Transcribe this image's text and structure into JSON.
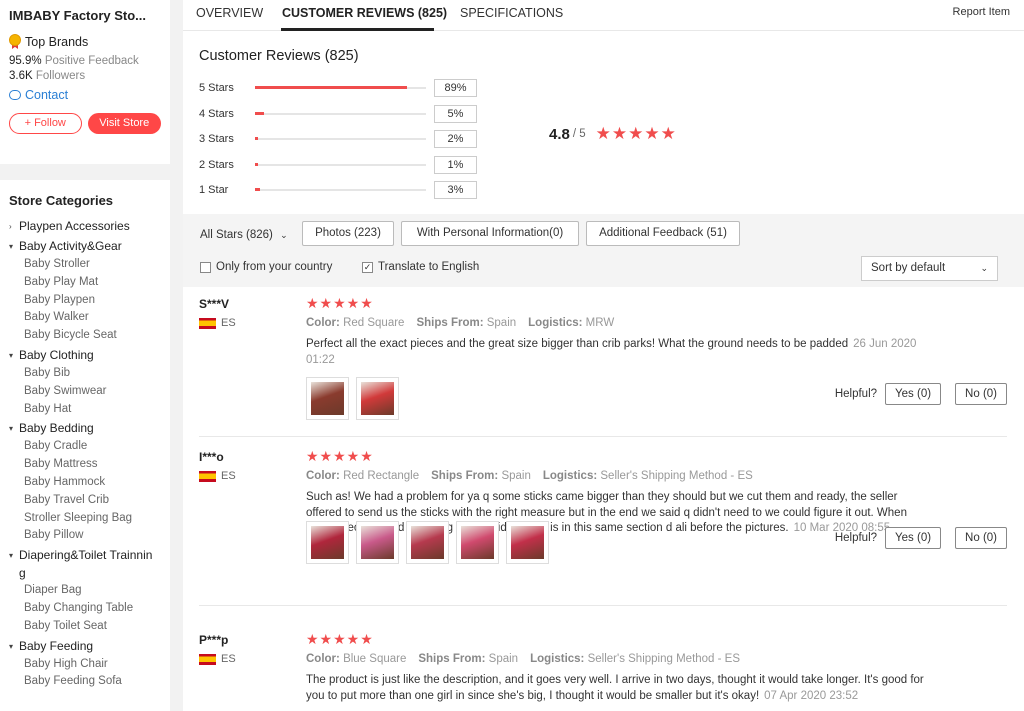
{
  "store": {
    "name": "IMBABY Factory Sto...",
    "badge": "Top Brands",
    "feedback_value": "95.9%",
    "feedback_label": "Positive Feedback",
    "followers_value": "3.6K",
    "followers_label": "Followers",
    "contact": "Contact",
    "follow_button": "+ Follow",
    "visit_button": "Visit Store"
  },
  "categories": {
    "title": "Store Categories",
    "groups": [
      {
        "label": "Playpen Accessories",
        "marker": "›",
        "items": []
      },
      {
        "label": "Baby Activity&Gear",
        "marker": "▾",
        "items": [
          "Baby Stroller",
          "Baby Play Mat",
          "Baby Playpen",
          "Baby Walker",
          "Baby Bicycle Seat"
        ]
      },
      {
        "label": "Baby Clothing",
        "marker": "▾",
        "items": [
          "Baby Bib",
          "Baby Swimwear",
          "Baby Hat"
        ]
      },
      {
        "label": "Baby Bedding",
        "marker": "▾",
        "items": [
          "Baby Cradle",
          "Baby Mattress",
          "Baby Hammock",
          "Baby Travel Crib",
          "Stroller Sleeping Bag",
          "Baby Pillow"
        ]
      },
      {
        "label": "Diapering&Toilet Trainnin g",
        "marker": "▾",
        "items": [
          "Diaper Bag",
          "Baby Changing Table",
          "Baby Toilet Seat"
        ]
      },
      {
        "label": "Baby Feeding",
        "marker": "▾",
        "items": [
          "Baby High Chair",
          "Baby Feeding Sofa"
        ]
      }
    ]
  },
  "tabs": {
    "overview": "OVERVIEW",
    "reviews": "CUSTOMER REVIEWS (825)",
    "specs": "SPECIFICATIONS",
    "report": "Report Item"
  },
  "summary": {
    "title": "Customer Reviews (825)",
    "rating": "4.8",
    "rating_of": "/ 5",
    "rating_stars": "★★★★★",
    "distribution": [
      {
        "label": "5 Stars",
        "pct": "89%",
        "value": 89
      },
      {
        "label": "4 Stars",
        "pct": "5%",
        "value": 5
      },
      {
        "label": "3 Stars",
        "pct": "2%",
        "value": 2
      },
      {
        "label": "2 Stars",
        "pct": "1%",
        "value": 1
      },
      {
        "label": "1 Star",
        "pct": "3%",
        "value": 3
      }
    ]
  },
  "filters": {
    "all_stars": "All Stars (826)",
    "photos": "Photos (223)",
    "personal": "With Personal Information(0)",
    "additional": "Additional Feedback (51)",
    "only_country": "Only from your country",
    "translate": "Translate to English",
    "sort": "Sort by default"
  },
  "colors": {
    "accent": "#ff4747",
    "star": "#f04d4d"
  },
  "reviews": [
    {
      "name": "S***V",
      "country": "ES",
      "stars": "★★★★★",
      "color_label": "Color:",
      "color": "Red Square",
      "ships_label": "Ships From:",
      "ships": "Spain",
      "logistics_label": "Logistics:",
      "logistics": "MRW",
      "text": "Perfect all the exact pieces and the great size bigger than crib parks! What the ground needs to be padded",
      "date": "26 Jun 2020 01:22",
      "helpful": "Helpful?",
      "yes": "Yes (0)",
      "no": "No (0)",
      "photo_count": 2
    },
    {
      "name": "I***o",
      "country": "ES",
      "stars": "★★★★★",
      "color_label": "Color:",
      "color": "Red Rectangle",
      "ships_label": "Ships From:",
      "ships": "Spain",
      "logistics_label": "Logistics:",
      "logistics": "Seller's Shipping Method - ES",
      "text": "Such as! We had a problem for ya q some sticks came bigger than they should but we cut them and ready, the seller offered to send us the sticks with the right measure but in the end we said q didn't need to we could figure it out. When riding I recommend watching before video what is in this same section d ali before the pictures.",
      "date": "10 Mar 2020 08:55",
      "helpful": "Helpful?",
      "yes": "Yes (0)",
      "no": "No (0)",
      "photo_count": 5
    },
    {
      "name": "P***p",
      "country": "ES",
      "stars": "★★★★★",
      "color_label": "Color:",
      "color": "Blue Square",
      "ships_label": "Ships From:",
      "ships": "Spain",
      "logistics_label": "Logistics:",
      "logistics": "Seller's Shipping Method - ES",
      "text": "The product is just like the description, and it goes very well. I arrive in two days, thought it would take longer. It's good for you to put more than one girl in since she's big, I thought it would be smaller but it's okay!",
      "date": "07 Apr 2020 23:52",
      "helpful": "",
      "yes": "",
      "no": "",
      "photo_count": 0
    }
  ]
}
